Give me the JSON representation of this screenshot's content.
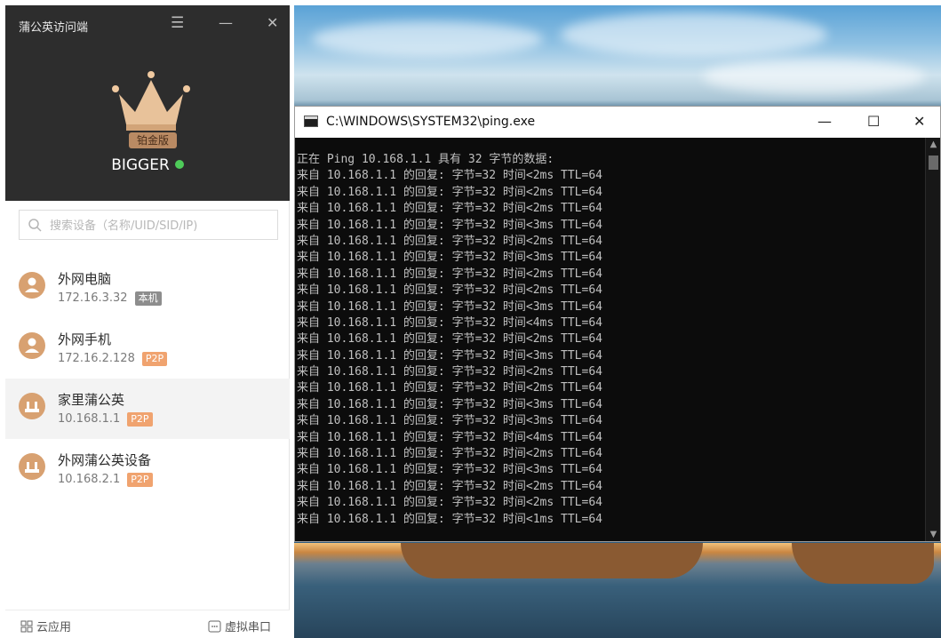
{
  "client": {
    "title": "蒲公英访问端",
    "plan_badge": "铂金版",
    "username": "BIGGER",
    "search_placeholder": "搜索设备（名称/UID/SID/IP)",
    "devices": [
      {
        "name": "外网电脑",
        "ip": "172.16.3.32",
        "tag": "本机",
        "icon": "user-icon"
      },
      {
        "name": "外网手机",
        "ip": "172.16.2.128",
        "tag": "P2P",
        "icon": "user-icon"
      },
      {
        "name": "家里蒲公英",
        "ip": "10.168.1.1",
        "tag": "P2P",
        "icon": "router-icon"
      },
      {
        "name": "外网蒲公英设备",
        "ip": "10.168.2.1",
        "tag": "P2P",
        "icon": "router-icon"
      }
    ],
    "bottom": {
      "cloud_apps": "云应用",
      "virtual_serial": "虚拟串口"
    },
    "colors": {
      "header": "#2d2d2d",
      "accent": "#d8a171",
      "online": "#4ecb59",
      "p2p_tag": "#f0a36f"
    }
  },
  "console": {
    "title": "C:\\WINDOWS\\SYSTEM32\\ping.exe",
    "header_line": "正在 Ping 10.168.1.1 具有 32 字节的数据:",
    "reply_lines": [
      "来自 10.168.1.1 的回复: 字节=32 时间<2ms TTL=64",
      "来自 10.168.1.1 的回复: 字节=32 时间<2ms TTL=64",
      "来自 10.168.1.1 的回复: 字节=32 时间<2ms TTL=64",
      "来自 10.168.1.1 的回复: 字节=32 时间<3ms TTL=64",
      "来自 10.168.1.1 的回复: 字节=32 时间<2ms TTL=64",
      "来自 10.168.1.1 的回复: 字节=32 时间<3ms TTL=64",
      "来自 10.168.1.1 的回复: 字节=32 时间<2ms TTL=64",
      "来自 10.168.1.1 的回复: 字节=32 时间<2ms TTL=64",
      "来自 10.168.1.1 的回复: 字节=32 时间<3ms TTL=64",
      "来自 10.168.1.1 的回复: 字节=32 时间<4ms TTL=64",
      "来自 10.168.1.1 的回复: 字节=32 时间<2ms TTL=64",
      "来自 10.168.1.1 的回复: 字节=32 时间<3ms TTL=64",
      "来自 10.168.1.1 的回复: 字节=32 时间<2ms TTL=64",
      "来自 10.168.1.1 的回复: 字节=32 时间<2ms TTL=64",
      "来自 10.168.1.1 的回复: 字节=32 时间<3ms TTL=64",
      "来自 10.168.1.1 的回复: 字节=32 时间<3ms TTL=64",
      "来自 10.168.1.1 的回复: 字节=32 时间<4ms TTL=64",
      "来自 10.168.1.1 的回复: 字节=32 时间<2ms TTL=64",
      "来自 10.168.1.1 的回复: 字节=32 时间<3ms TTL=64",
      "来自 10.168.1.1 的回复: 字节=32 时间<2ms TTL=64",
      "来自 10.168.1.1 的回复: 字节=32 时间<2ms TTL=64",
      "来自 10.168.1.1 的回复: 字节=32 时间<1ms TTL=64"
    ],
    "colors": {
      "background": "#0c0c0c",
      "text": "#c0c0c0"
    }
  }
}
